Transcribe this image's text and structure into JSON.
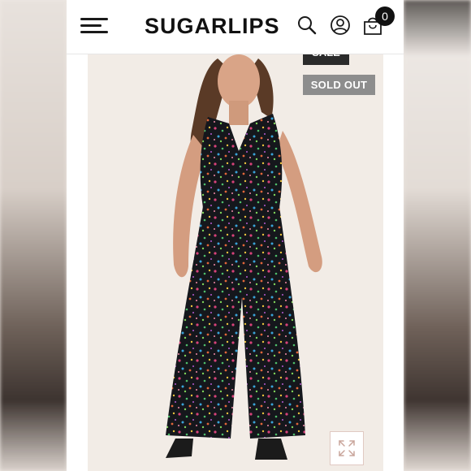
{
  "header": {
    "logo": "SUGARLIPS",
    "cart_count": "0",
    "icons": [
      "menu-icon",
      "search-icon",
      "account-icon",
      "cart-icon"
    ]
  },
  "product": {
    "badges": {
      "sale": "SALE",
      "sold_out": "SOLD OUT"
    },
    "image": "woman-in-floral-print-jumpsuit",
    "zoom_icon": "expand-icon"
  },
  "colors": {
    "brand_text": "#111111",
    "sold_out_badge": "#8d8d8d",
    "sale_badge": "#2b2b2b",
    "photo_bg": "#f2ece6"
  }
}
